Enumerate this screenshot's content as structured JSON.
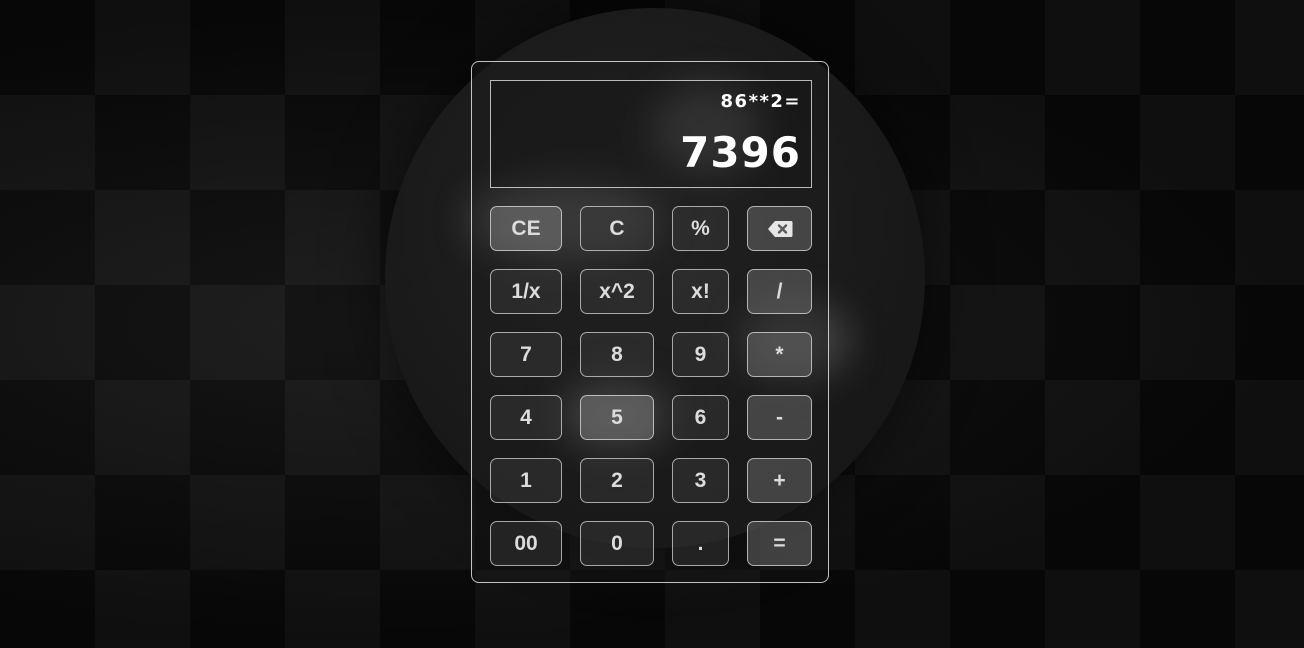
{
  "display": {
    "expression": "86**2=",
    "result": "7396"
  },
  "keys": {
    "ce": "CE",
    "c": "C",
    "percent": "%",
    "backspace_icon": "backspace-icon",
    "reciprocal": "1/x",
    "square": "x^2",
    "factorial": "x!",
    "divide": "/",
    "seven": "7",
    "eight": "8",
    "nine": "9",
    "multiply": "*",
    "four": "4",
    "five": "5",
    "six": "6",
    "subtract": "-",
    "one": "1",
    "two": "2",
    "three": "3",
    "add": "+",
    "double_zero": "00",
    "zero": "0",
    "decimal": ".",
    "equals": "="
  }
}
